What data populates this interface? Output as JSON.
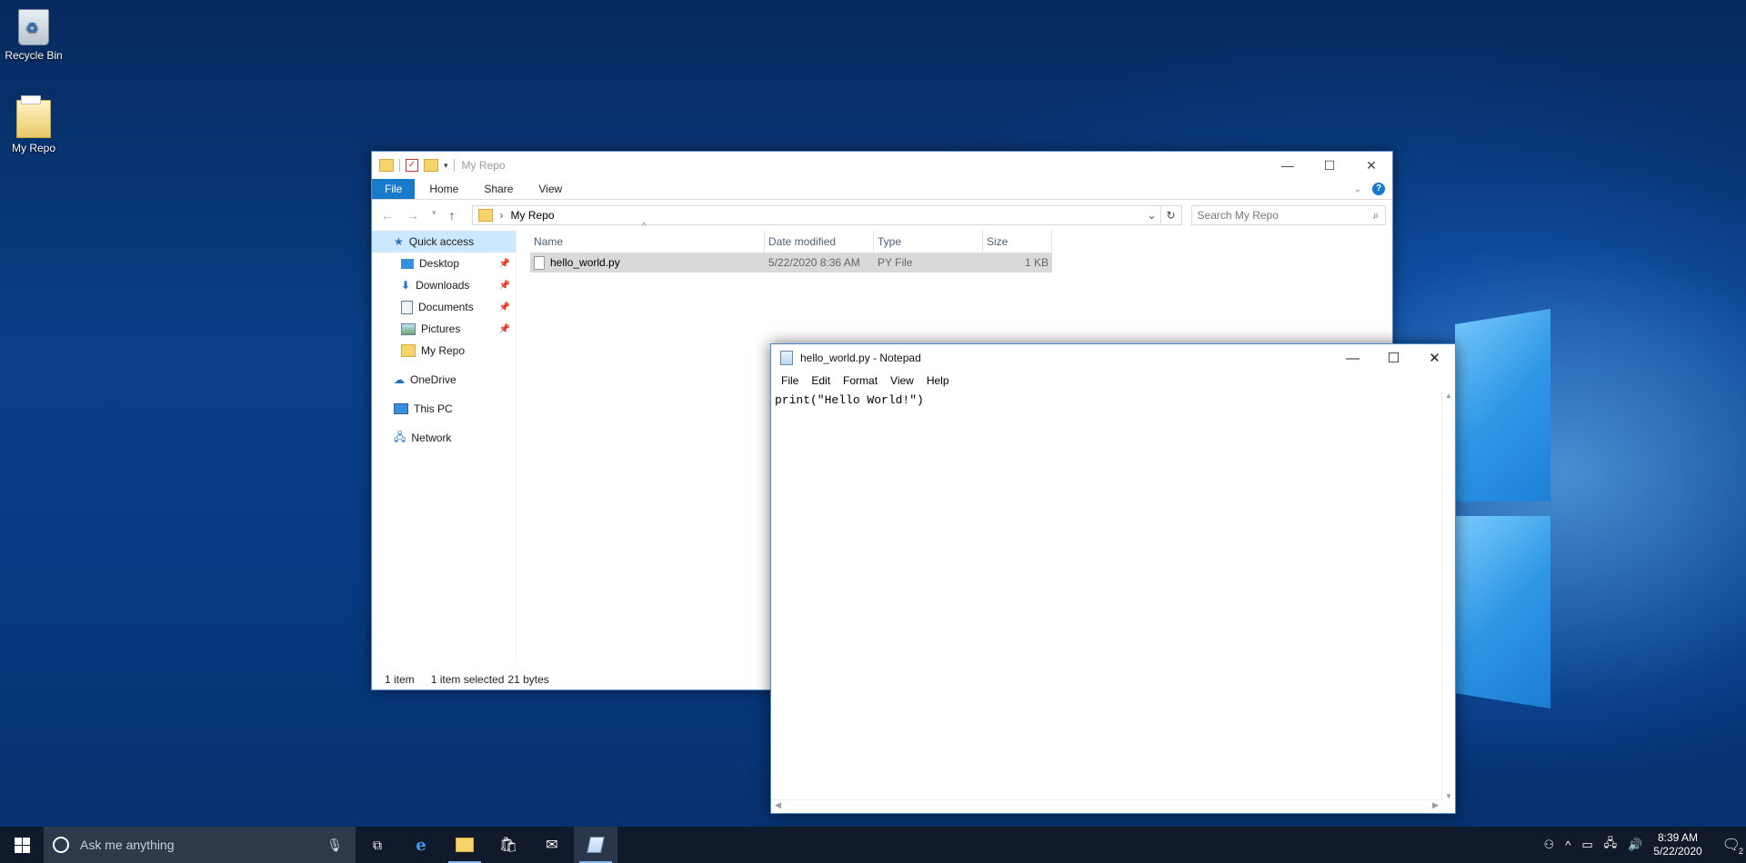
{
  "desktop": {
    "icons": [
      {
        "label": "Recycle Bin"
      },
      {
        "label": "My Repo"
      }
    ]
  },
  "explorer": {
    "title": "My Repo",
    "ribbon_tabs": [
      "File",
      "Home",
      "Share",
      "View"
    ],
    "address": "My Repo",
    "search_placeholder": "Search My Repo",
    "nav": {
      "quick_access": "Quick access",
      "items": [
        {
          "label": "Desktop",
          "icon": "desktop-icon",
          "pinned": true
        },
        {
          "label": "Downloads",
          "icon": "download-icon",
          "pinned": true
        },
        {
          "label": "Documents",
          "icon": "documents-icon",
          "pinned": true
        },
        {
          "label": "Pictures",
          "icon": "pictures-icon",
          "pinned": true
        },
        {
          "label": "My Repo",
          "icon": "folder-icon",
          "pinned": false
        }
      ],
      "onedrive": "OneDrive",
      "this_pc": "This PC",
      "network": "Network"
    },
    "columns": [
      "Name",
      "Date modified",
      "Type",
      "Size"
    ],
    "files": [
      {
        "name": "hello_world.py",
        "date": "5/22/2020 8:36 AM",
        "type": "PY File",
        "size": "1 KB"
      }
    ],
    "status": {
      "count": "1 item",
      "selected": "1 item selected",
      "bytes": "21 bytes"
    }
  },
  "notepad": {
    "title": "hello_world.py - Notepad",
    "menu": [
      "File",
      "Edit",
      "Format",
      "View",
      "Help"
    ],
    "content": "print(\"Hello World!\")"
  },
  "taskbar": {
    "search_placeholder": "Ask me anything",
    "time": "8:39 AM",
    "date": "5/22/2020",
    "notifications": "2"
  },
  "colors": {
    "accent": "#1979ca",
    "selection": "#cce8ff",
    "taskbar": "#101a2a"
  }
}
